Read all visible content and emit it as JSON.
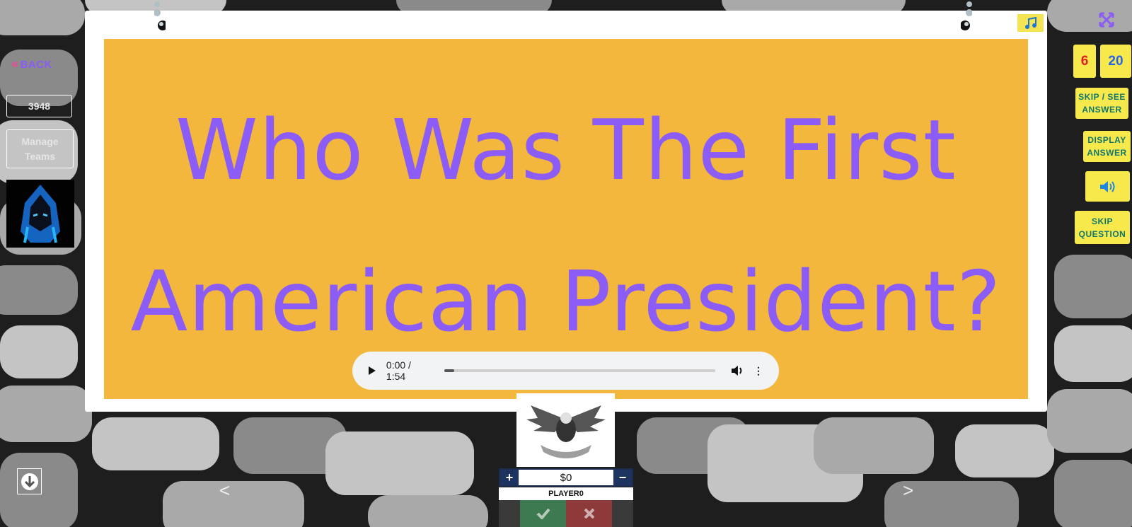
{
  "nav": {
    "back_label": "BACK"
  },
  "game": {
    "code": "3948",
    "manage_teams_label": "Manage Teams"
  },
  "question": {
    "text": "Who Was The First American President?"
  },
  "audio": {
    "time": "0:00 / 1:54"
  },
  "counters": {
    "current": "6",
    "total": "20"
  },
  "controls": {
    "skip_see_answer": "SKIP / SEE ANSWER",
    "display_answer": "DISPLAY ANSWER",
    "skip_question": "SKIP QUESTION"
  },
  "player": {
    "score": "$0",
    "name": "PLAYER0"
  },
  "arrows": {
    "prev": "<",
    "next": ">"
  },
  "colors": {
    "accent_purple": "#8b5cf6",
    "panel_orange": "#f2b73c",
    "button_yellow": "#f7e94b"
  },
  "icons": [
    "music-icon",
    "expand-icon",
    "volume-icon",
    "down-arrow-icon",
    "check-icon",
    "close-icon",
    "plus-icon",
    "minus-icon",
    "play-icon"
  ]
}
